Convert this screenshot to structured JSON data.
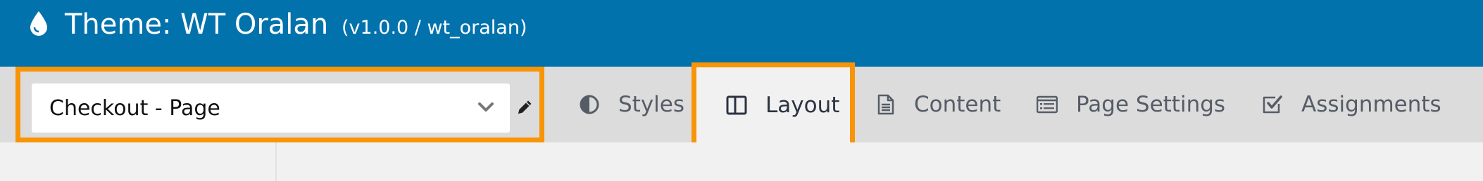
{
  "header": {
    "title": "Theme: WT Oralan",
    "version": "(v1.0.0 / wt_oralan)",
    "icon": "drop-icon",
    "background_color": "#0272ad"
  },
  "layout_select": {
    "selected_value": "Checkout - Page",
    "icon": "chevron-down-icon",
    "edit_icon": "pencil-icon"
  },
  "tabs": [
    {
      "label": "Styles",
      "icon": "contrast-icon",
      "active": false
    },
    {
      "label": "Layout",
      "icon": "columns-icon",
      "active": true
    },
    {
      "label": "Content",
      "icon": "document-icon",
      "active": false
    },
    {
      "label": "Page Settings",
      "icon": "list-window-icon",
      "active": false
    },
    {
      "label": "Assignments",
      "icon": "checkbox-icon",
      "active": false
    }
  ],
  "highlight_color": "#f89406"
}
